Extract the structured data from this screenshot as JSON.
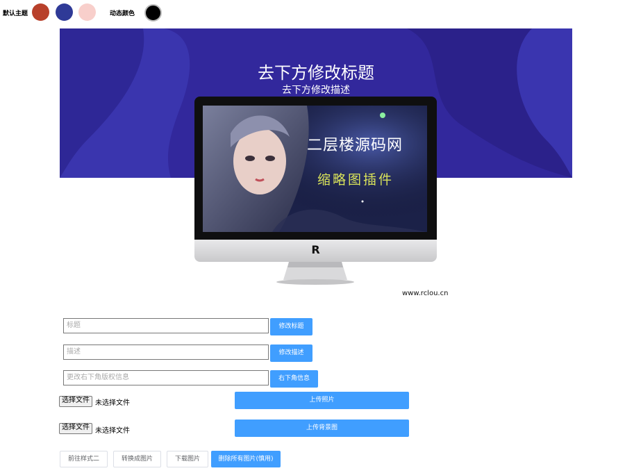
{
  "theme": {
    "default_label": "默认主题",
    "dynamic_label": "动态颜色",
    "swatches": [
      "#b8402b",
      "#2f3a97",
      "#f8cfcb"
    ],
    "dynamic_color": "#000000"
  },
  "banner": {
    "title": "去下方修改标题",
    "description": "去下方修改描述",
    "background": "#32289c"
  },
  "thumbnail": {
    "title": "二层楼源码网",
    "subtitle": "缩略图插件",
    "monitor_logo": "R",
    "site_url": "www.rclou.cn"
  },
  "form": {
    "title_placeholder": "标题",
    "title_button": "修改标题",
    "desc_placeholder": "描述",
    "desc_button": "修改描述",
    "copyright_placeholder": "更改右下角版权信息",
    "copyright_button": "右下角信息",
    "file_button": "选择文件",
    "file_none": "未选择文件",
    "upload_photo": "上传照片",
    "upload_bg": "上传背景图"
  },
  "actions": {
    "style_two": "前往样式二",
    "convert": "转换成图片",
    "download": "下载图片",
    "delete_all": "删除所有图片(慎用)"
  }
}
